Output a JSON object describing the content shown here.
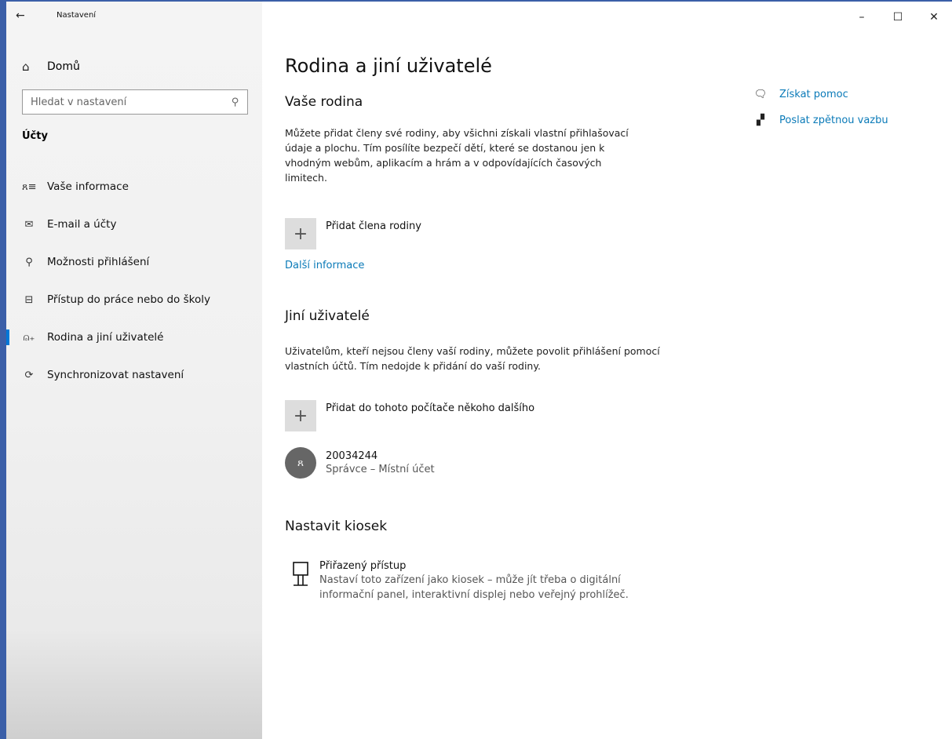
{
  "window": {
    "title": "Nastavení",
    "back_icon": "←",
    "minimize": "–",
    "maximize": "☐",
    "close": "✕"
  },
  "sidebar": {
    "home_label": "Domů",
    "search_placeholder": "Hledat v nastavení",
    "section_label": "Účty",
    "items": [
      {
        "label": "Vaše informace",
        "icon": "person-card-icon",
        "glyph": "ጸ≡"
      },
      {
        "label": "E-mail a účty",
        "icon": "mail-icon",
        "glyph": "✉"
      },
      {
        "label": "Možnosti přihlášení",
        "icon": "key-icon",
        "glyph": "⚲"
      },
      {
        "label": "Přístup do práce nebo do školy",
        "icon": "briefcase-icon",
        "glyph": "⊟"
      },
      {
        "label": "Rodina a jiní uživatelé",
        "icon": "add-person-icon",
        "glyph": "⍝₊",
        "active": true
      },
      {
        "label": "Synchronizovat nastavení",
        "icon": "sync-icon",
        "glyph": "⟳"
      }
    ]
  },
  "main": {
    "title": "Rodina a jiní uživatelé",
    "family": {
      "heading": "Vaše rodina",
      "description": "Můžete přidat členy své rodiny, aby všichni získali vlastní přihlašovací údaje a plochu. Tím posílíte bezpečí dětí, které se dostanou jen k vhodným webům, aplikacím a hrám a v odpovídajících časových limitech.",
      "add_label": "Přidat člena rodiny",
      "more_info": "Další informace"
    },
    "others": {
      "heading": "Jiní uživatelé",
      "description": "Uživatelům, kteří nejsou členy vaší rodiny, můžete povolit přihlášení pomocí vlastních účtů. Tím nedojde k přidání do vaší rodiny.",
      "add_label": "Přidat do tohoto počítače někoho dalšího",
      "user_name": "20034244",
      "user_role": "Správce – Místní účet"
    },
    "kiosk": {
      "heading": "Nastavit kiosek",
      "title": "Přiřazený přístup",
      "description": "Nastaví toto zařízení jako kiosek – může jít třeba o digitální informační panel, interaktivní displej nebo veřejný prohlížeč."
    },
    "help": {
      "get_help": "Získat pomoc",
      "feedback": "Poslat zpětnou vazbu"
    }
  },
  "colors": {
    "accent": "#0078d7",
    "link": "#0a7ab8",
    "frame": "#3b5fa8"
  }
}
